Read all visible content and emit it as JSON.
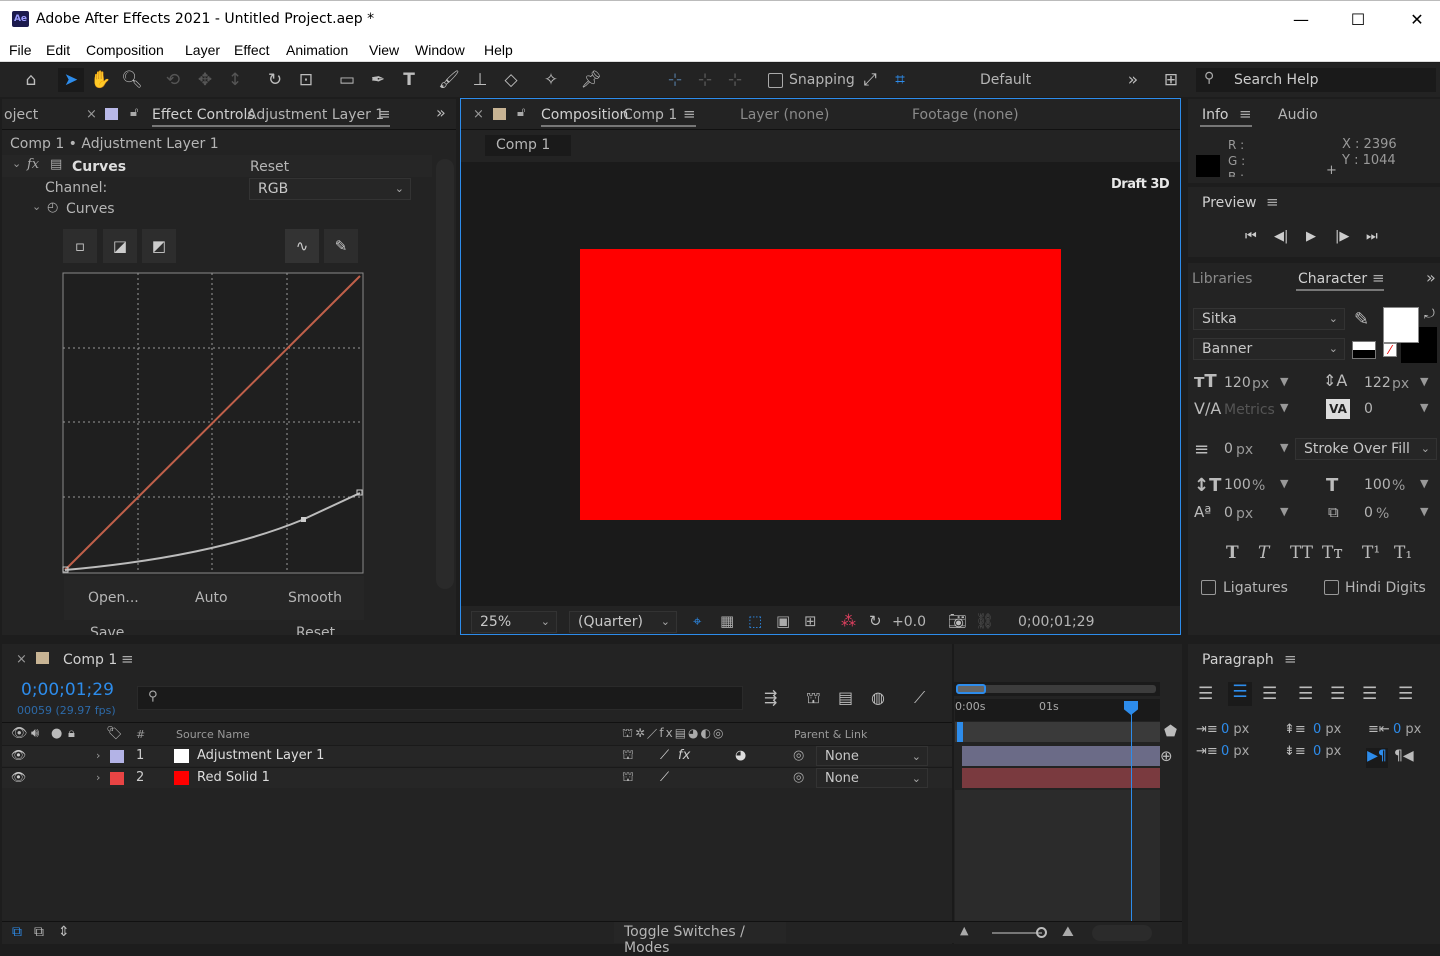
{
  "window": {
    "title": "Adobe After Effects 2021 - Untitled Project.aep *",
    "logo": "Ae",
    "min": "—",
    "max": "☐",
    "close": "✕"
  },
  "menu": [
    "File",
    "Edit",
    "Composition",
    "Layer",
    "Effect",
    "Animation",
    "View",
    "Window",
    "Help"
  ],
  "toolbar": {
    "snapping": "Snapping",
    "workspace": "Default",
    "search": "Search Help"
  },
  "effect_panel": {
    "project_tab": "oject",
    "tab_label": "Effect Controls",
    "tab_layer": "Adjustment Layer 1",
    "breadcrumb": "Comp 1 • Adjustment Layer 1",
    "effect_name": "Curves",
    "reset": "Reset",
    "channel_label": "Channel:",
    "channel_value": "RGB",
    "curves_label": "Curves",
    "btn_open": "Open...",
    "btn_auto": "Auto",
    "btn_smooth": "Smooth",
    "btn_save": "Save",
    "btn_reset": "Reset"
  },
  "comp_panel": {
    "tab_label": "Composition",
    "tab_comp": "Comp 1",
    "layer_tab": "Layer",
    "layer_val": "(none)",
    "footage_tab": "Footage",
    "footage_val": "(none)",
    "crumb": "Comp 1",
    "renderer": "Draft 3D",
    "zoom": "25%",
    "resolution": "(Quarter)",
    "exposure": "+0.0",
    "timecode": "0;00;01;29",
    "solid_color": "#ff0000"
  },
  "info_panel": {
    "tab_info": "Info",
    "tab_audio": "Audio",
    "r": "R :",
    "g": "G :",
    "b": "B :",
    "x": "X : 2396",
    "y": "Y : 1044"
  },
  "preview_panel": {
    "title": "Preview"
  },
  "character_panel": {
    "tab_libraries": "Libraries",
    "tab_character": "Character",
    "font": "Sitka",
    "style": "Banner",
    "size": "120",
    "size_unit": "px",
    "leading": "122",
    "leading_unit": "px",
    "kerning": "Metrics",
    "tracking": "0",
    "stroke": "0",
    "stroke_unit": "px",
    "stroke_mode": "Stroke Over Fill",
    "vscale": "100",
    "vscale_unit": "%",
    "hscale": "100",
    "hscale_unit": "%",
    "baseline": "0",
    "baseline_unit": "px",
    "tsume": "0",
    "tsume_unit": "%",
    "ligatures": "Ligatures",
    "hindi": "Hindi Digits"
  },
  "paragraph_panel": {
    "title": "Paragraph",
    "v1": "0",
    "v2": "0",
    "v3": "0",
    "v4": "0",
    "v5": "0",
    "unit": "px"
  },
  "timeline": {
    "tab": "Comp 1",
    "timecode": "0;00;01;29",
    "frames": "00059 (29.97 fps)",
    "col_num": "#",
    "col_source": "Source Name",
    "col_parent": "Parent & Link",
    "ruler_0": "0:00s",
    "ruler_1": "01s",
    "toggle": "Toggle Switches / Modes",
    "layers": [
      {
        "num": "1",
        "name": "Adjustment Layer 1",
        "label_color": "#b3b3e6",
        "swatch": "#ffffff",
        "parent": "None",
        "bar_color": "#6b6b87"
      },
      {
        "num": "2",
        "name": "Red Solid 1",
        "label_color": "#e84444",
        "swatch": "#ff0000",
        "parent": "None",
        "bar_color": "#7a3a3f"
      }
    ]
  }
}
